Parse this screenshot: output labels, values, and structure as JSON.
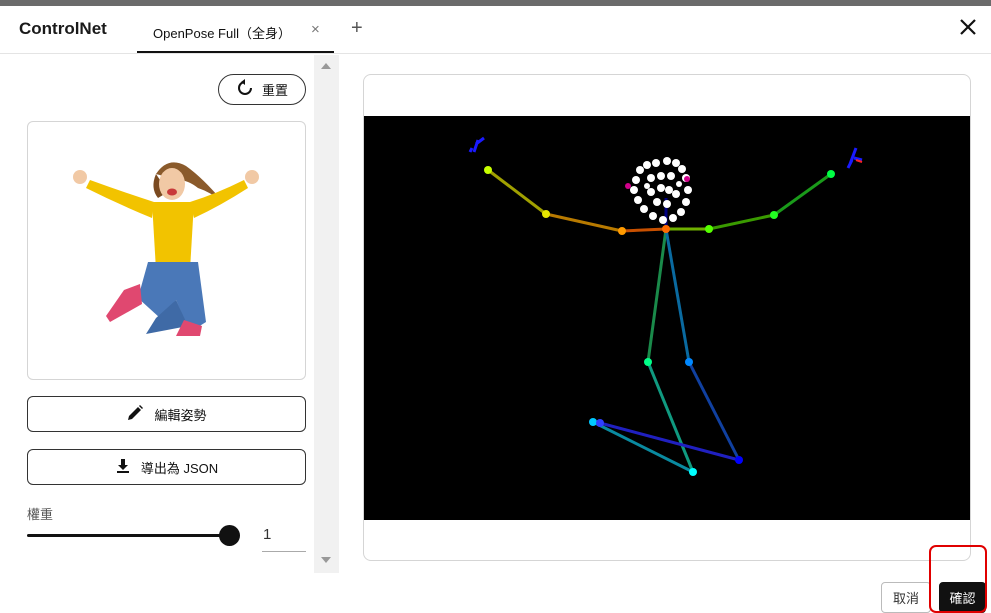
{
  "app": {
    "title": "ControlNet"
  },
  "tabs": [
    {
      "label": "OpenPose Full（全身）",
      "close_symbol": "×"
    }
  ],
  "tab_add_symbol": "+",
  "left_panel": {
    "reset_label": "重置",
    "edit_pose_label": "編輯姿勢",
    "export_label": "導出為 JSON",
    "weight_label": "權重",
    "weight_value": "1",
    "weight_fraction": 1.0
  },
  "footer": {
    "cancel_label": "取消",
    "confirm_label": "確認"
  },
  "colors": {
    "canvas_bg": "#000000",
    "confirm_bg": "#111111",
    "highlight": "#e00000",
    "shirt": "#f2c300",
    "jeans": "#4a78b8"
  },
  "icons": {
    "reset": "rotate-ccw-icon",
    "edit": "pencil-icon",
    "export": "download-icon",
    "close": "close-icon",
    "add": "plus-icon"
  }
}
